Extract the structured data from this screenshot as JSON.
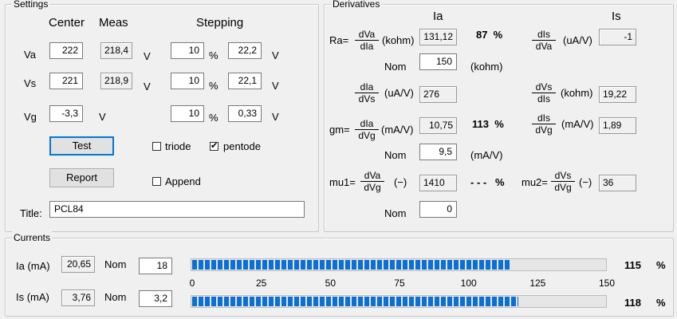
{
  "settings": {
    "title": "Settings",
    "col_center": "Center",
    "col_meas": "Meas",
    "col_stepping": "Stepping",
    "rows": [
      {
        "label": "Va",
        "center": "222",
        "meas": "218,4",
        "unit1": "V",
        "step_pct": "10",
        "pct": "%",
        "step_val": "22,2",
        "unit2": "V"
      },
      {
        "label": "Vs",
        "center": "221",
        "meas": "218,9",
        "unit1": "V",
        "step_pct": "10",
        "pct": "%",
        "step_val": "22,1",
        "unit2": "V"
      },
      {
        "label": "Vg",
        "center": "-3,3",
        "meas": "",
        "unit1": "V",
        "step_pct": "10",
        "pct": "%",
        "step_val": "0,33",
        "unit2": "V"
      }
    ],
    "test_label": "Test",
    "report_label": "Report",
    "triode_label": "triode",
    "triode_checked": false,
    "pentode_label": "pentode",
    "pentode_checked": true,
    "append_label": "Append",
    "append_checked": false,
    "title_label": "Title:",
    "title_value": "PCL84"
  },
  "derivatives": {
    "title": "Derivatives",
    "col_ia": "Ia",
    "col_is": "Is",
    "ra_label": "Ra=",
    "ra_num": "dVa",
    "ra_den": "dIa",
    "ra_unit": "(kohm)",
    "ra_value": "131,12",
    "ra_pct": "87  %",
    "ra_nom_label": "Nom",
    "ra_nom_value": "150",
    "ra_nom_unit": "(kohm)",
    "dis_dva_num": "dIs",
    "dis_dva_den": "dVa",
    "dis_dva_unit": "(uA/V)",
    "dis_dva_value": "-1",
    "dia_dvs_num": "dIa",
    "dia_dvs_den": "dVs",
    "dia_dvs_unit": "(uA/V)",
    "dia_dvs_value": "276",
    "dvs_dis_num": "dVs",
    "dvs_dis_den": "dIs",
    "dvs_dis_unit": "(kohm)",
    "dvs_dis_value": "19,22",
    "gm_label": "gm=",
    "gm_num": "dIa",
    "gm_den": "dVg",
    "gm_unit": "(mA/V)",
    "gm_value": "10,75",
    "gm_pct": "113  %",
    "gm_nom_label": "Nom",
    "gm_nom_value": "9,5",
    "gm_nom_unit": "(mA/V)",
    "dis_dvg_num": "dIs",
    "dis_dvg_den": "dVg",
    "dis_dvg_unit": "(mA/V)",
    "dis_dvg_value": "1,89",
    "mu1_label": "mu1=",
    "mu1_num": "dVa",
    "mu1_den": "dVg",
    "mu1_unit": "(−)",
    "mu1_value": "1410",
    "mu1_pct": "- - -   %",
    "mu1_nom_label": "Nom",
    "mu1_nom_value": "0",
    "mu2_label": "mu2=",
    "mu2_num": "dVs",
    "mu2_den": "dVg",
    "mu2_unit": "(−)",
    "mu2_value": "36"
  },
  "currents": {
    "title": "Currents",
    "ia_label": "Ia (mA)",
    "ia_value": "20,65",
    "ia_nom_label": "Nom",
    "ia_nom_value": "18",
    "ia_pct_value": 115,
    "ia_pct_text": "115",
    "ia_pct_sign": "%",
    "is_label": "Is (mA)",
    "is_value": "3,76",
    "is_nom_label": "Nom",
    "is_nom_value": "3,2",
    "is_pct_value": 118,
    "is_pct_text": "118",
    "is_pct_sign": "%",
    "scale_max": 150,
    "ticks": [
      "0",
      "25",
      "50",
      "75",
      "100",
      "125",
      "150"
    ]
  }
}
